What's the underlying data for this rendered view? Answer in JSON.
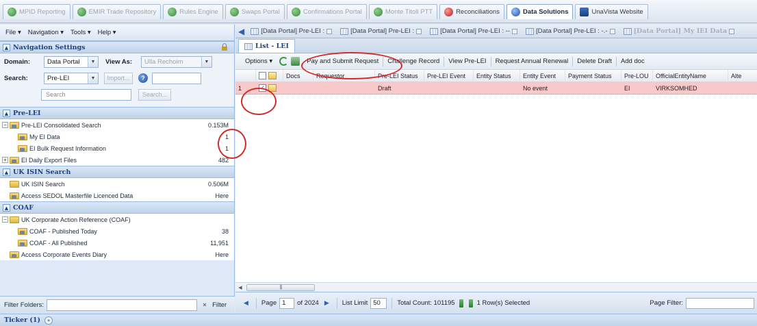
{
  "app_tabs": [
    {
      "label": "MPID Reporting",
      "icon": "green",
      "state": "inactive"
    },
    {
      "label": "EMIR Trade Repository",
      "icon": "green",
      "state": "inactive"
    },
    {
      "label": "Rules Engine",
      "icon": "green",
      "state": "inactive"
    },
    {
      "label": "Swaps Portal",
      "icon": "green",
      "state": "inactive"
    },
    {
      "label": "Confirmations Portal",
      "icon": "green",
      "state": "inactive"
    },
    {
      "label": "Monte Titoli PTT",
      "icon": "green",
      "state": "inactive"
    },
    {
      "label": "Reconciliations",
      "icon": "red",
      "state": "bold"
    },
    {
      "label": "Data Solutions",
      "icon": "blue",
      "state": "active"
    },
    {
      "label": "UnaVista Website",
      "icon": "square",
      "state": "bold"
    }
  ],
  "menu": {
    "file": "File ▾",
    "navigation": "Navigation ▾",
    "tools": "Tools ▾",
    "help": "Help ▾"
  },
  "nav_settings": {
    "title": "Navigation Settings",
    "domain_label": "Domain:",
    "domain_value": "Data Portal",
    "view_as_label": "View As:",
    "view_as_value": "Ulla Rechoim",
    "search_label": "Search:",
    "search_value": "Pre-LEI",
    "import_label": "Import...",
    "search_placeholder": "Search",
    "search_button": "Search..."
  },
  "sections": {
    "pre_lei": {
      "title": "Pre-LEI",
      "items": [
        {
          "label": "Pre-LEI Consolidated Search",
          "value": "0.153M"
        },
        {
          "label": "My EI Data",
          "value": "1"
        },
        {
          "label": "EI Bulk Request Information",
          "value": "1"
        },
        {
          "label": "EI Daily Export Files",
          "value": "482"
        }
      ]
    },
    "uk_isin": {
      "title": "UK ISIN Search",
      "items": [
        {
          "label": "UK ISIN Search",
          "value": "0.506M"
        },
        {
          "label": "Access SEDOL Masterfile Licenced Data",
          "value": "Here"
        }
      ]
    },
    "coaf": {
      "title": "COAF",
      "items": [
        {
          "label": "UK Corporate Action Reference (COAF)",
          "value": ""
        },
        {
          "label": "COAF - Published Today",
          "value": "38"
        },
        {
          "label": "COAF - All Published",
          "value": "11,951"
        },
        {
          "label": "Access Corporate Events Diary",
          "value": "Here"
        }
      ]
    }
  },
  "filter": {
    "label": "Filter Folders:",
    "button": "Filter",
    "clear": "×"
  },
  "doc_tabs": [
    "[Data Portal] Pre-LEI : ",
    "[Data Portal] Pre-LEI : ",
    "[Data Portal] Pre-LEI : -- ",
    "[Data Portal] Pre-LEI : -.- ",
    "[Data Portal] My IEI Data "
  ],
  "list_tab": "List - LEI",
  "toolbar": {
    "options": "Options ▾",
    "pay_submit": "Pay and Submit Request",
    "challenge": "Challenge Record",
    "view_pre_lei": "View Pre-LEI",
    "annual_renewal": "Request Annual Renewal",
    "delete_draft": "Delete Draft",
    "add_doc": "Add doc"
  },
  "grid": {
    "columns": [
      "Docs",
      "Requestor",
      "Pre-LEI Status",
      "Pre-LEI Event",
      "Entity Status",
      "Entity Event",
      "Payment Status",
      "Pre-LOU",
      "OfficialEntityName",
      "Alte"
    ],
    "rows": [
      {
        "num": "1",
        "checked": "✓",
        "docs": "",
        "requestor": "",
        "status": "Draft",
        "event": "",
        "entity_status": "",
        "entity_event": "No event",
        "payment_status": "",
        "pre_lou": "EI",
        "name": "VIRKSOMHED",
        "alt": ""
      }
    ]
  },
  "pager": {
    "page_label": "Page",
    "page_value": "1",
    "of_label": "of 2024",
    "list_limit_label": "List Limit",
    "list_limit_value": "50",
    "total_count": "Total Count: 101195",
    "selected": "1 Row(s) Selected",
    "page_filter_label": "Page Filter:"
  },
  "ticker": {
    "label": "Ticker (1)"
  },
  "colors": {
    "accent": "#15428b",
    "selected_row": "#f9c9c9",
    "annotation": "#d42a2a"
  }
}
